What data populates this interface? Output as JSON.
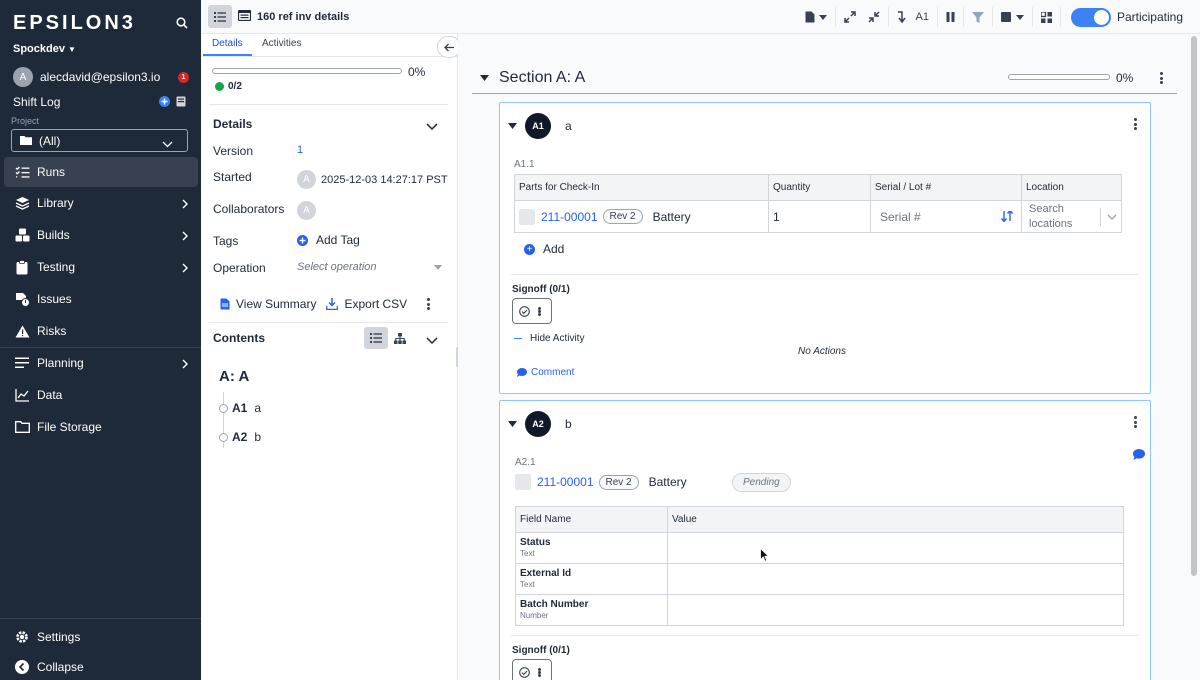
{
  "nav": {
    "logo": "EPSILON3",
    "workspace": "Spockdev",
    "user_initial": "A",
    "user_email": "alecdavid@epsilon3.io",
    "notification_count": "1",
    "shift_log": "Shift Log",
    "project_label": "Project",
    "project_value": "(All)",
    "items": [
      {
        "label": "Runs",
        "icon": "runs-icon"
      },
      {
        "label": "Library",
        "icon": "library-icon"
      },
      {
        "label": "Builds",
        "icon": "builds-icon"
      },
      {
        "label": "Testing",
        "icon": "testing-icon"
      },
      {
        "label": "Issues",
        "icon": "issues-icon"
      },
      {
        "label": "Risks",
        "icon": "risks-icon"
      },
      {
        "label": "Planning",
        "icon": "planning-icon"
      },
      {
        "label": "Data",
        "icon": "data-icon"
      },
      {
        "label": "File Storage",
        "icon": "folder-icon"
      }
    ],
    "settings": "Settings",
    "collapse": "Collapse"
  },
  "topbar": {
    "title": "160 ref inv details",
    "step_jump": "A1",
    "participating": "Participating",
    "participating_on": true
  },
  "side": {
    "tabs": [
      "Details",
      "Activities"
    ],
    "progress_pct": "0%",
    "progress_fraction": 0,
    "count": "0/2",
    "details_heading": "Details",
    "version_label": "Version",
    "version_value": "1",
    "started_label": "Started",
    "started_initial": "A",
    "started_value": "2025-12-03 14:27:17 PST",
    "collaborators_label": "Collaborators",
    "collaborator_initial": "A",
    "tags_label": "Tags",
    "add_tag": "Add Tag",
    "operation_label": "Operation",
    "operation_placeholder": "Select operation",
    "view_summary": "View Summary",
    "export_csv": "Export CSV",
    "contents_heading": "Contents",
    "toc_section": "A: A",
    "toc_items": [
      {
        "id": "A1",
        "name": "a"
      },
      {
        "id": "A2",
        "name": "b"
      }
    ]
  },
  "main": {
    "section_title": "Section A: A",
    "section_progress_pct": "0%",
    "section_progress_fraction": 0,
    "steps": [
      {
        "badge": "A1",
        "name": "a",
        "block_id": "A1.1",
        "columns": [
          "Parts for Check-In",
          "Quantity",
          "Serial / Lot #",
          "Location"
        ],
        "row": {
          "part_number": "211-00001",
          "rev": "Rev 2",
          "part_name": "Battery",
          "quantity": "1",
          "serial_placeholder": "Serial #",
          "location_placeholder": "Search locations"
        },
        "add_label": "Add",
        "signoff": "Signoff (0/1)",
        "hide_activity": "Hide Activity",
        "no_actions": "No Actions",
        "comment": "Comment"
      },
      {
        "badge": "A2",
        "name": "b",
        "block_id": "A2.1",
        "part_number": "211-00001",
        "rev": "Rev 2",
        "part_name": "Battery",
        "status": "Pending",
        "columns": [
          "Field Name",
          "Value"
        ],
        "fields": [
          {
            "name": "Status",
            "type": "Text",
            "value": ""
          },
          {
            "name": "External Id",
            "type": "Text",
            "value": ""
          },
          {
            "name": "Batch Number",
            "type": "Number",
            "value": ""
          }
        ],
        "signoff": "Signoff (0/1)"
      }
    ]
  },
  "colors": {
    "nav_bg": "#1e2939",
    "accent": "#3b82f6",
    "link": "#2563eb",
    "card_border": "#93c5fd",
    "success": "#16a34a",
    "danger": "#dc2626"
  }
}
